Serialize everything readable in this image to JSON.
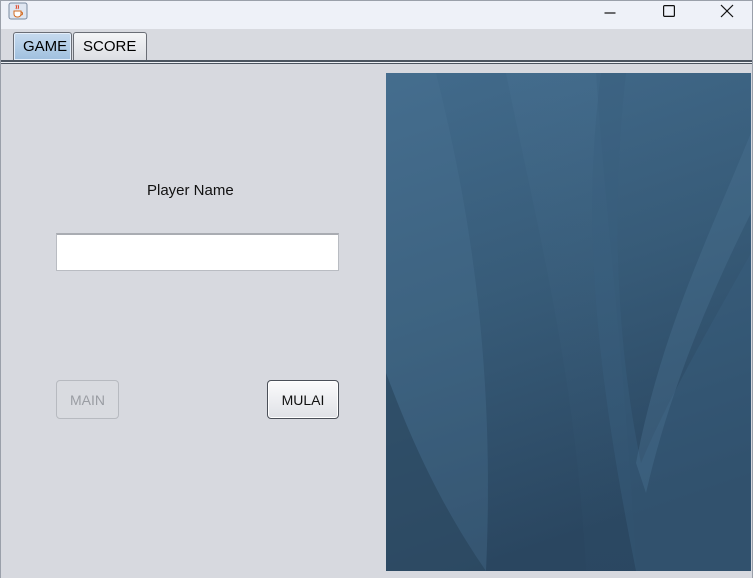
{
  "window": {
    "title": "",
    "controls": [
      "minimize",
      "maximize",
      "close"
    ]
  },
  "tabs": [
    {
      "label": "GAME",
      "selected": true
    },
    {
      "label": "SCORE",
      "selected": false
    }
  ],
  "game": {
    "player_name_label": "Player Name",
    "player_name_value": "",
    "main_button": {
      "label": "MAIN",
      "enabled": false
    },
    "mulai_button": {
      "label": "MULAI",
      "enabled": true
    }
  },
  "colors": {
    "selected_tab": "#a9c7e4",
    "panel_bg": "#d7d9df",
    "wallpaper": "#3b5b78"
  },
  "icons": {
    "app": "java-cup-icon",
    "minimize": "minimize-icon",
    "maximize": "maximize-icon",
    "close": "close-icon"
  }
}
